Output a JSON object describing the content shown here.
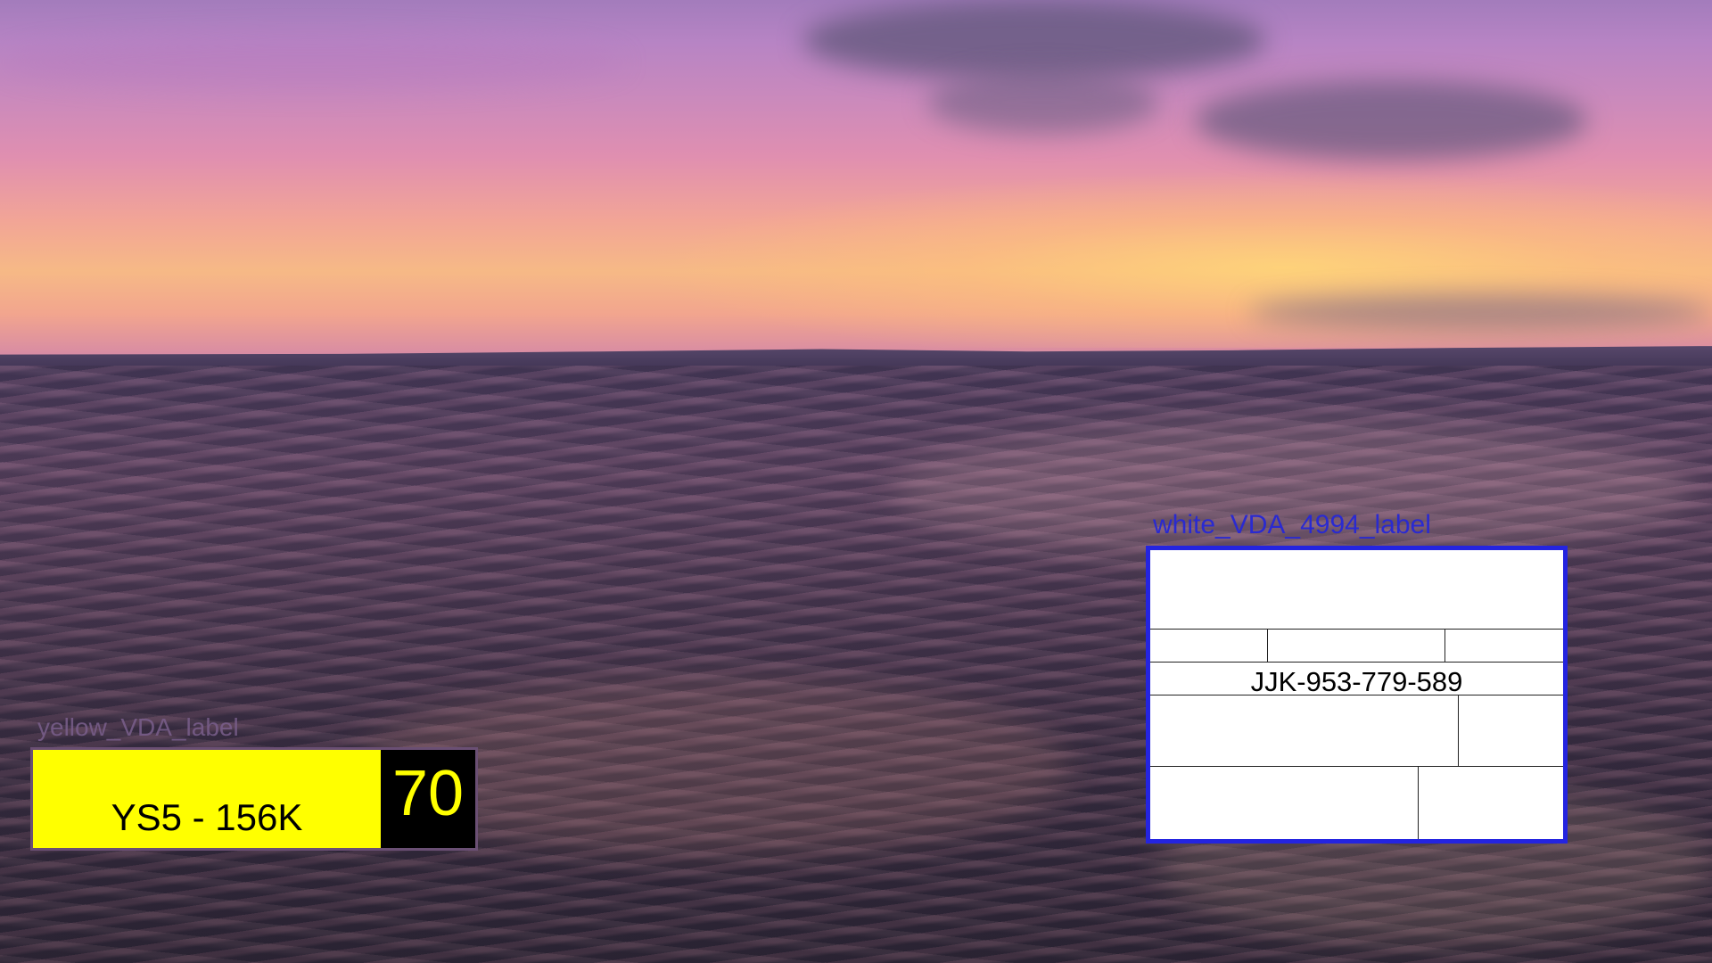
{
  "yellow_label": {
    "caption": "yellow_VDA_label",
    "code": "YS5 - 156K",
    "number": "70"
  },
  "white_label": {
    "caption": "white_VDA_4994_label",
    "code": "JJK-953-779-589"
  }
}
